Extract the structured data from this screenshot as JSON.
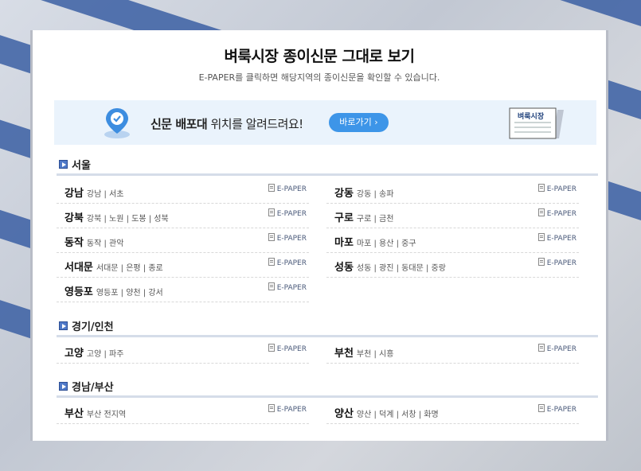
{
  "header": {
    "title": "벼룩시장 종이신문 그대로 보기",
    "subtitle": "E-PAPER를 클릭하면 해당지역의 종이신문을 확인할 수 있습니다."
  },
  "banner": {
    "text_bold": "신문 배포대",
    "text_rest": " 위치를 알려드려요!",
    "button_label": "바로가기 ›",
    "paper_label": "벼룩시장"
  },
  "epaper_label": "E-PAPER",
  "sections": [
    {
      "title": "서울",
      "items": [
        {
          "name": "강남",
          "areas": "강남 | 서초"
        },
        {
          "name": "강동",
          "areas": "강동 | 송파"
        },
        {
          "name": "강북",
          "areas": "강북 | 노원 | 도봉 | 성북"
        },
        {
          "name": "구로",
          "areas": "구로 | 금천"
        },
        {
          "name": "동작",
          "areas": "동작 | 관악"
        },
        {
          "name": "마포",
          "areas": "마포 | 용산 | 중구"
        },
        {
          "name": "서대문",
          "areas": "서대문 | 은평 | 종로"
        },
        {
          "name": "성동",
          "areas": "성동 | 광진 | 동대문 | 중랑"
        },
        {
          "name": "영등포",
          "areas": "영등포 | 양천 | 강서"
        }
      ]
    },
    {
      "title": "경기/인천",
      "items": [
        {
          "name": "고양",
          "areas": "고양 | 파주"
        },
        {
          "name": "부천",
          "areas": "부천 | 시흥"
        }
      ]
    },
    {
      "title": "경남/부산",
      "items": [
        {
          "name": "부산",
          "areas": "부산 전지역"
        },
        {
          "name": "양산",
          "areas": "양산 | 덕계 | 서창 | 화명"
        }
      ]
    }
  ]
}
